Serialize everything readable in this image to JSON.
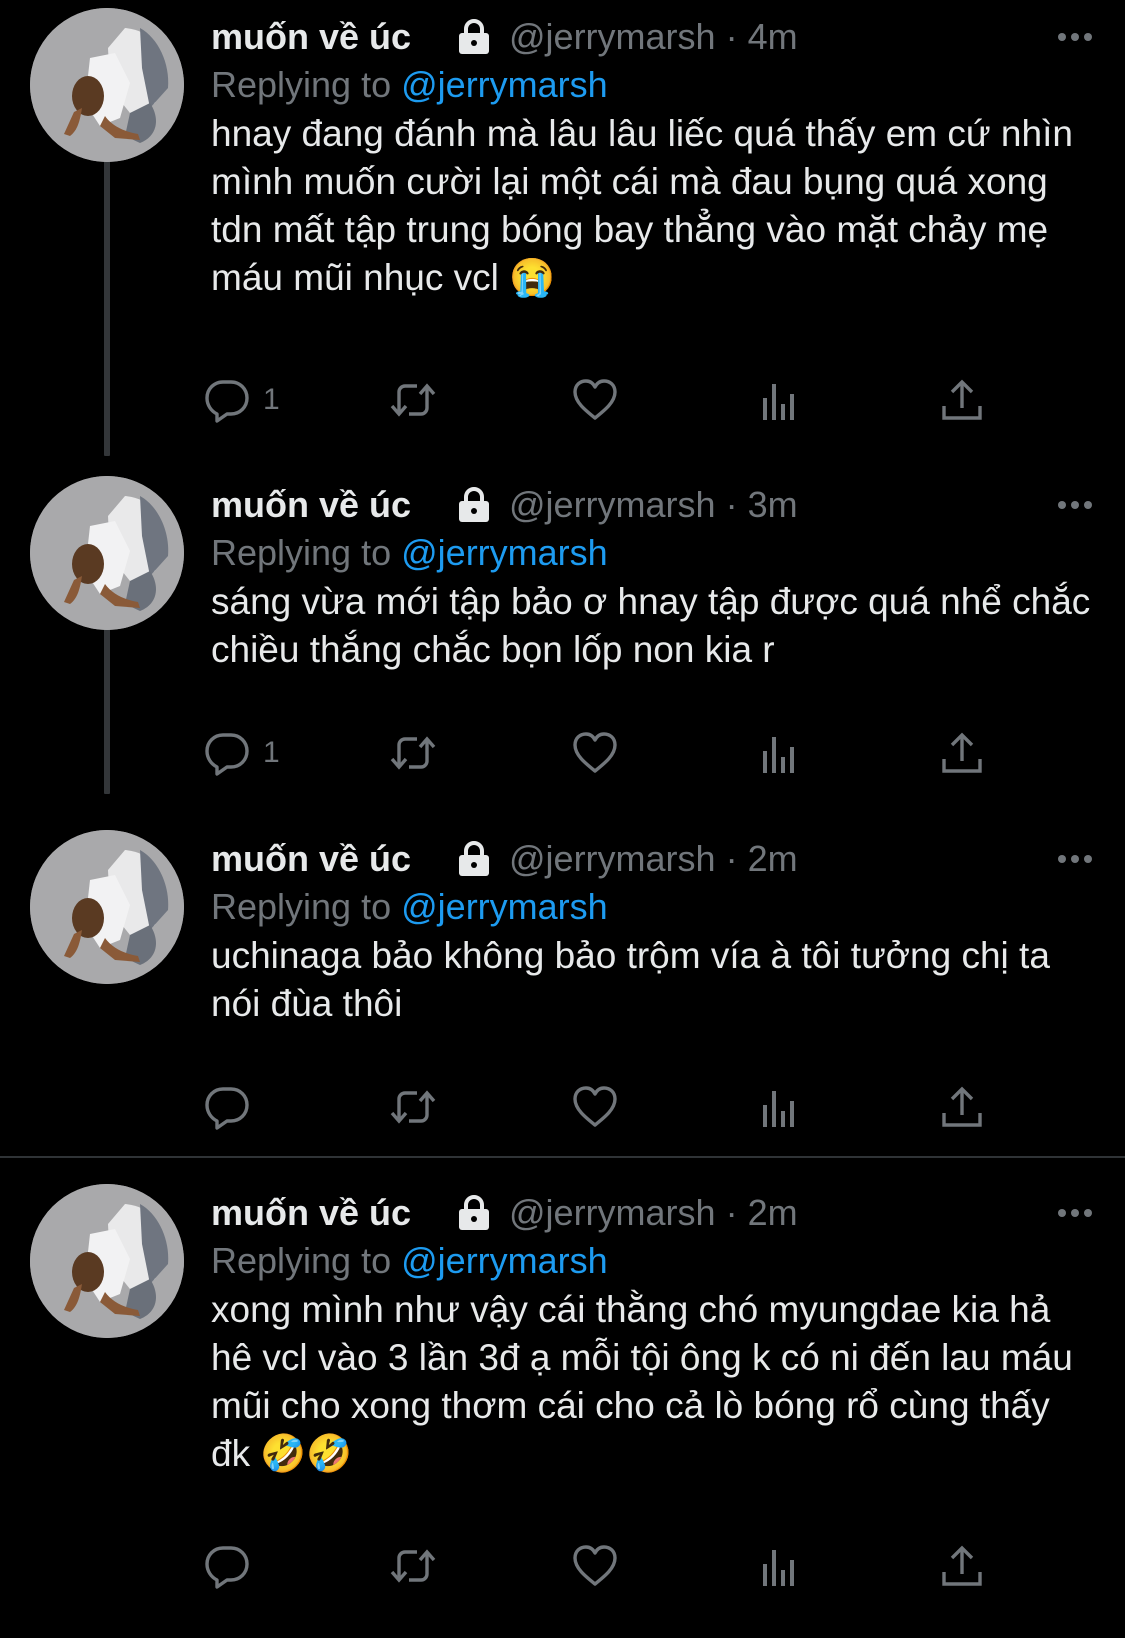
{
  "colors": {
    "background": "#000000",
    "text": "#e7e9ea",
    "muted": "#71767b",
    "link": "#1d9bf0",
    "thread_line": "#333639"
  },
  "icons": {
    "lock": "lock-icon",
    "more": "more-horizontal-icon",
    "reply": "reply-icon",
    "retweet": "retweet-icon",
    "like": "heart-icon",
    "views": "views-icon",
    "share": "share-icon"
  },
  "tweets": [
    {
      "name": "muốn về úc",
      "handle": "@jerrymarsh",
      "time": "4m",
      "replying_label": "Replying to",
      "replying_to": "@jerrymarsh",
      "text": "hnay đang đánh mà lâu lâu liếc quá thấy em cứ nhìn mình muốn cười lại một cái mà đau bụng quá xong tdn mất tập trung bóng bay thẳng vào mặt chảy mẹ máu mũi nhục vcl 😭",
      "reply_count": "1"
    },
    {
      "name": "muốn về úc",
      "handle": "@jerrymarsh",
      "time": "3m",
      "replying_label": "Replying to",
      "replying_to": "@jerrymarsh",
      "text": "sáng vừa mới tập bảo ơ hnay tập được quá nhể chắc chiều thắng chắc bọn lốp non kia r",
      "reply_count": "1"
    },
    {
      "name": "muốn về úc",
      "handle": "@jerrymarsh",
      "time": "2m",
      "replying_label": "Replying to",
      "replying_to": "@jerrymarsh",
      "text": "uchinaga bảo không bảo trộm vía à tôi tưởng chị ta nói đùa thôi",
      "reply_count": ""
    },
    {
      "name": "muốn về úc",
      "handle": "@jerrymarsh",
      "time": "2m",
      "replying_label": "Replying to",
      "replying_to": "@jerrymarsh",
      "text": "xong mình như vậy cái thằng chó myungdae kia hả hê vcl vào 3 lần 3đ ạ mỗi tội ông k có ni đến lau máu mũi cho xong thơm cái cho cả lò bóng rổ cùng thấy đk 🤣🤣",
      "reply_count": ""
    }
  ]
}
